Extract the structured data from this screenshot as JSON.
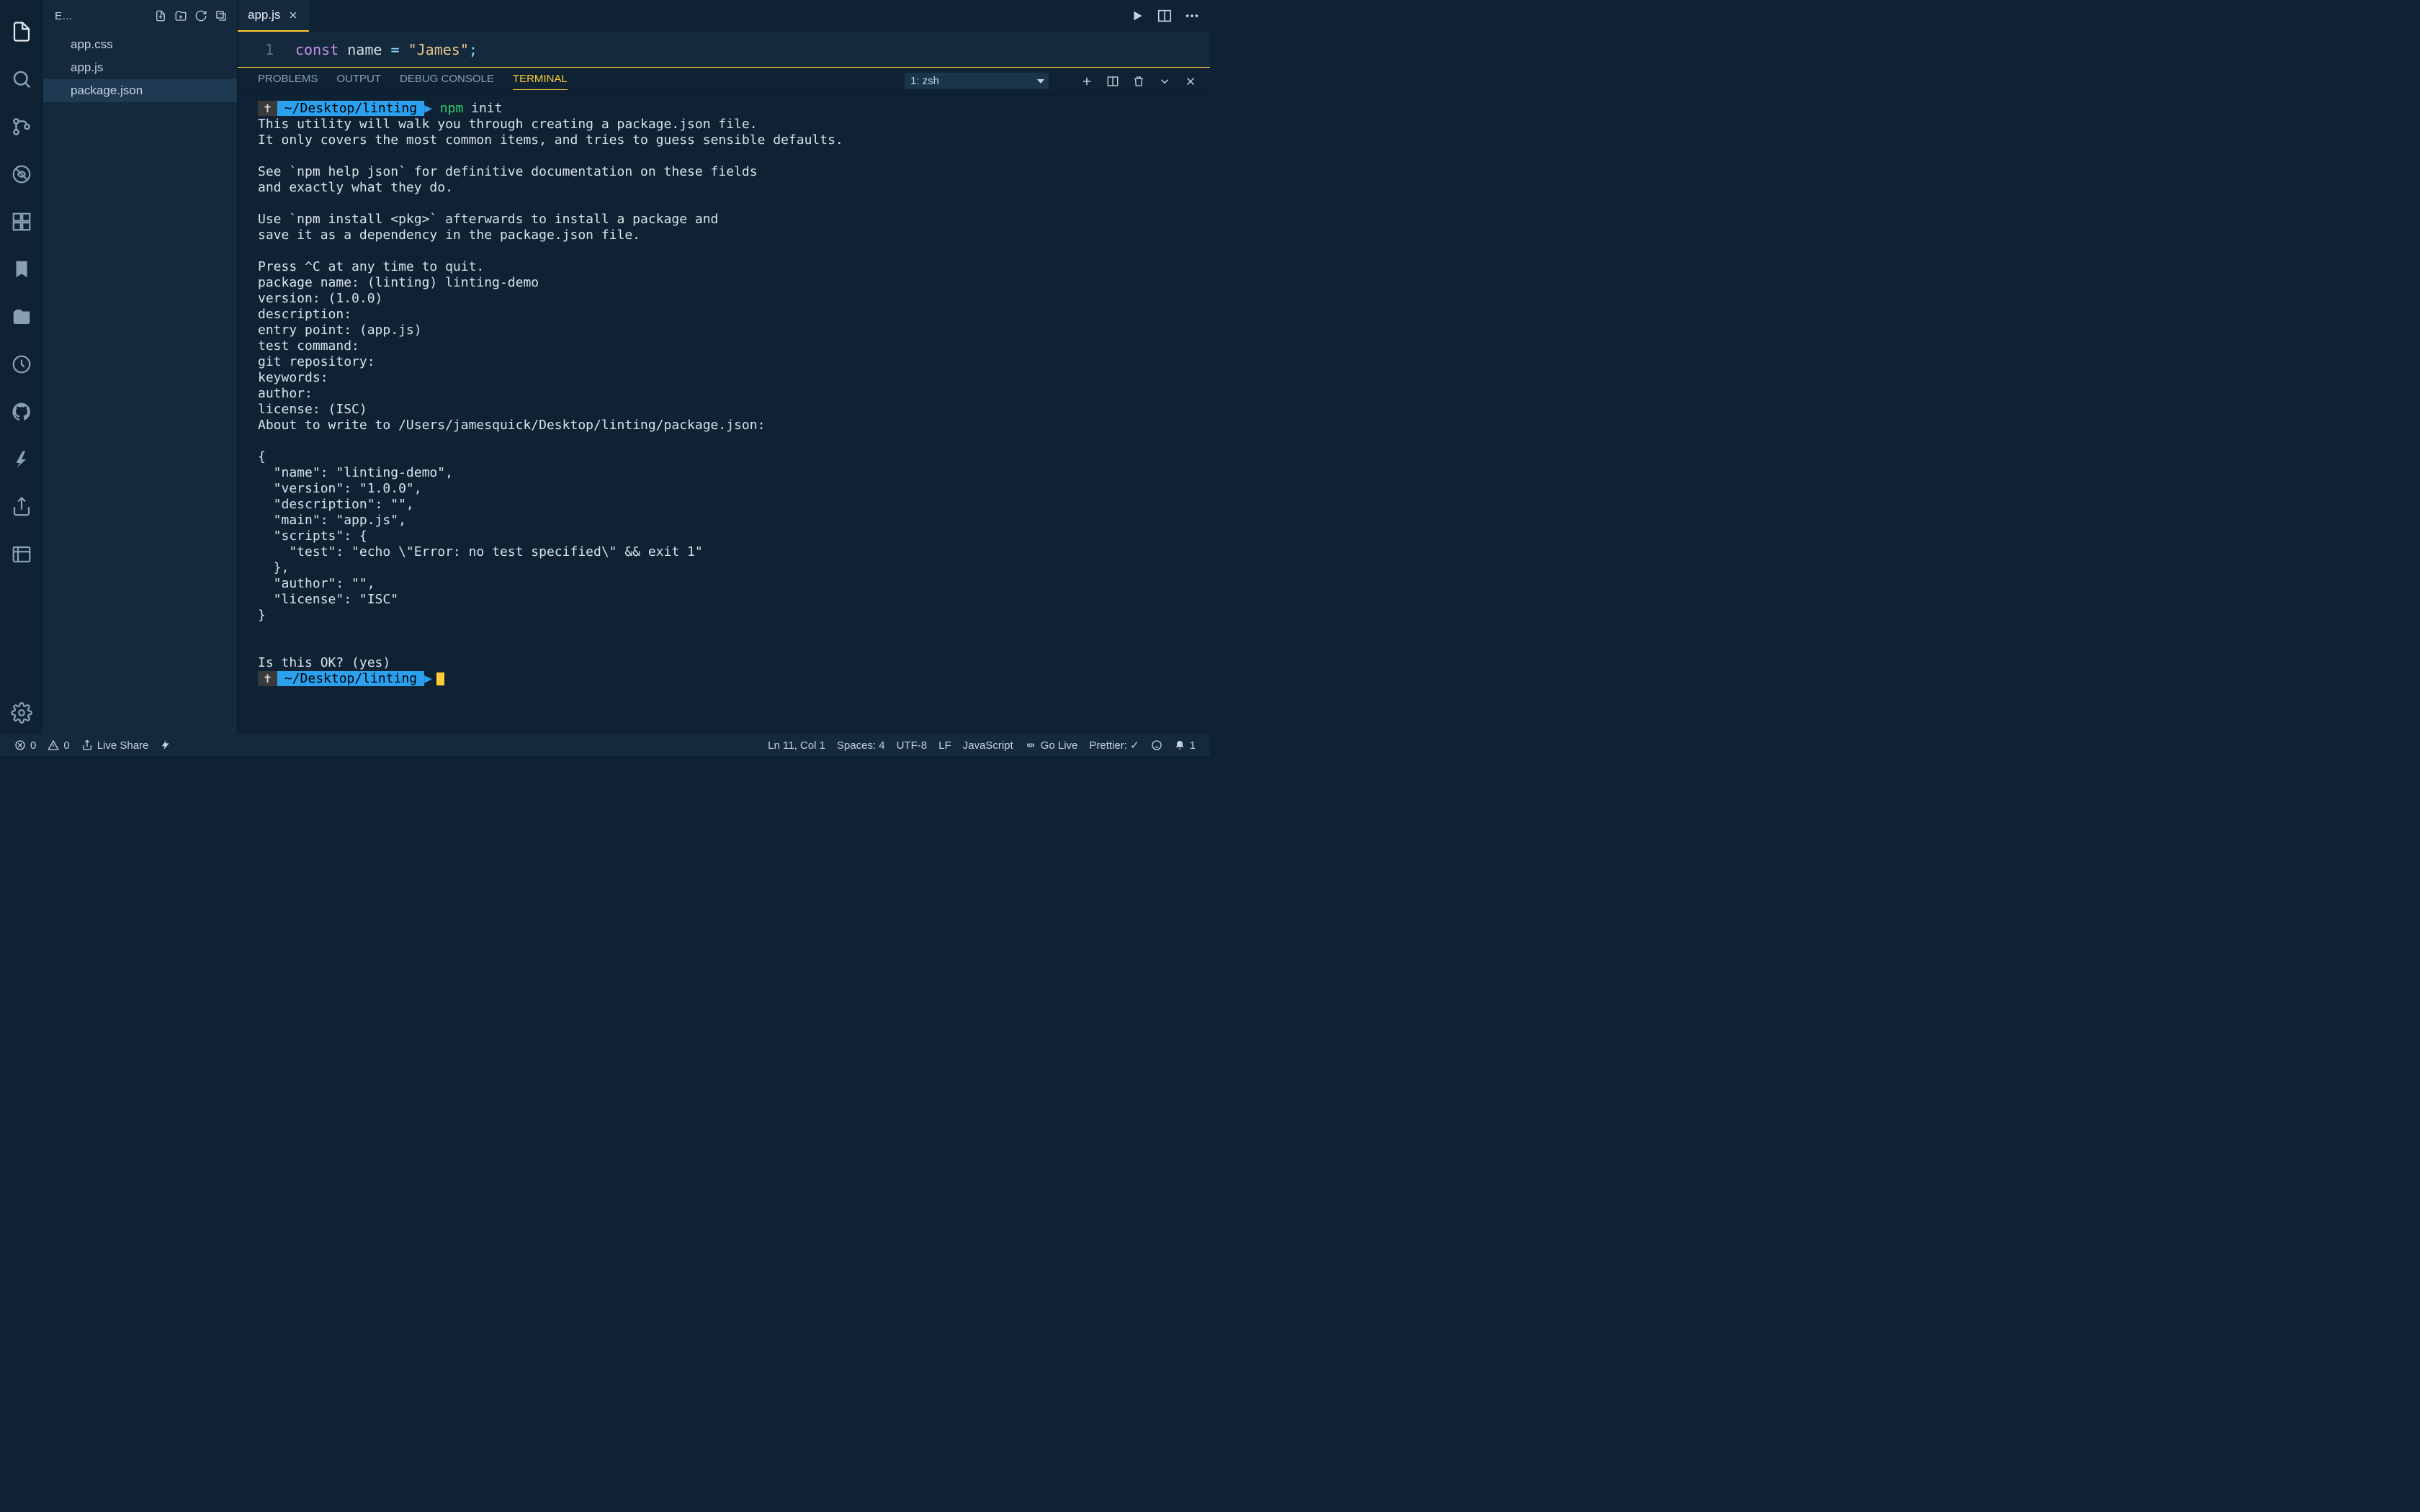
{
  "sidebar": {
    "title": "E…",
    "files": [
      "app.css",
      "app.js",
      "package.json"
    ],
    "selected_index": 2
  },
  "editor": {
    "tab_label": "app.js",
    "line_number": "1",
    "code": {
      "kw": "const",
      "sp1": " ",
      "id": "name",
      "sp2": " ",
      "op": "=",
      "sp3": " ",
      "str": "\"James\"",
      "punc": ";"
    }
  },
  "panel": {
    "tabs": [
      "PROBLEMS",
      "OUTPUT",
      "DEBUG CONSOLE",
      "TERMINAL"
    ],
    "active_tab_index": 3,
    "terminal_selector": "1: zsh"
  },
  "terminal": {
    "prompt_symbol": "✝",
    "prompt_path": "~/Desktop/linting",
    "cmd1": "npm",
    "cmd1_arg": " init",
    "body": "This utility will walk you through creating a package.json file.\nIt only covers the most common items, and tries to guess sensible defaults.\n\nSee `npm help json` for definitive documentation on these fields\nand exactly what they do.\n\nUse `npm install <pkg>` afterwards to install a package and\nsave it as a dependency in the package.json file.\n\nPress ^C at any time to quit.\npackage name: (linting) linting-demo\nversion: (1.0.0)\ndescription:\nentry point: (app.js)\ntest command:\ngit repository:\nkeywords:\nauthor:\nlicense: (ISC)\nAbout to write to /Users/jamesquick/Desktop/linting/package.json:\n\n{\n  \"name\": \"linting-demo\",\n  \"version\": \"1.0.0\",\n  \"description\": \"\",\n  \"main\": \"app.js\",\n  \"scripts\": {\n    \"test\": \"echo \\\"Error: no test specified\\\" && exit 1\"\n  },\n  \"author\": \"\",\n  \"license\": \"ISC\"\n}\n\n\nIs this OK? (yes)"
  },
  "status": {
    "errors": "0",
    "warnings": "0",
    "live_share": "Live Share",
    "ln_col": "Ln 11, Col 1",
    "spaces": "Spaces: 4",
    "encoding": "UTF-8",
    "eol": "LF",
    "language": "JavaScript",
    "go_live": "Go Live",
    "prettier": "Prettier: ✓",
    "bell_count": "1"
  }
}
